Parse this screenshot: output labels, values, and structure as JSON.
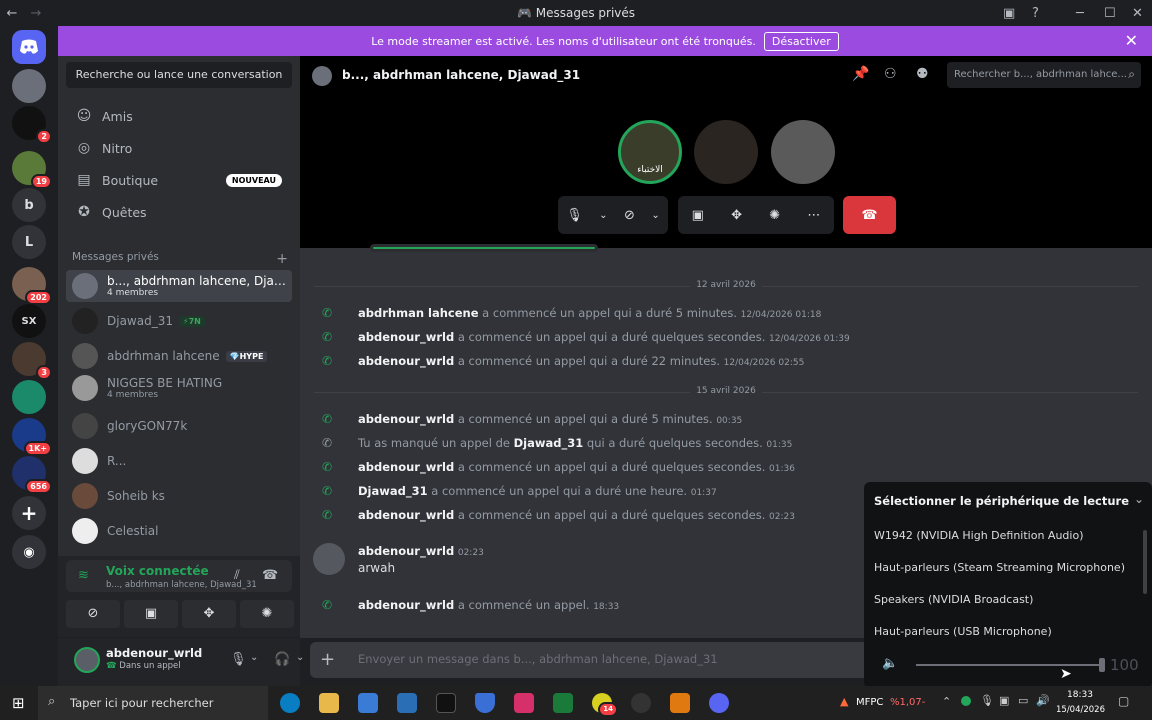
{
  "window": {
    "title": "Messages privés",
    "back": "←",
    "forward": "→"
  },
  "streamer": {
    "text": "Le mode streamer est activé. Les noms d'utilisateur ont été tronqués.",
    "button": "Désactiver"
  },
  "guilds": [
    {
      "label": "",
      "badge": ""
    },
    {
      "label": "",
      "badge": "2"
    },
    {
      "label": "",
      "badge": "19"
    },
    {
      "label": "b",
      "badge": ""
    },
    {
      "label": "L",
      "badge": ""
    },
    {
      "label": "",
      "badge": "202"
    },
    {
      "label": "SX",
      "badge": ""
    },
    {
      "label": "",
      "badge": "3"
    },
    {
      "label": "",
      "badge": ""
    },
    {
      "label": "",
      "badge": "1K+"
    },
    {
      "label": "",
      "badge": "656"
    }
  ],
  "sidebar": {
    "search": "Recherche ou lance une conversation",
    "nav": [
      {
        "label": "Amis",
        "icon": "friends-icon"
      },
      {
        "label": "Nitro",
        "icon": "nitro-icon"
      },
      {
        "label": "Boutique",
        "icon": "shop-icon",
        "badge": "NOUVEAU"
      },
      {
        "label": "Quêtes",
        "icon": "quests-icon"
      }
    ],
    "section": "Messages privés",
    "add": "+",
    "dms": [
      {
        "name": "b..., abdrhman lahcene, Djawad...",
        "sub": "4 membres",
        "tag": ""
      },
      {
        "name": "Djawad_31",
        "sub": "",
        "tag": "⚡7N"
      },
      {
        "name": "abdrhman lahcene",
        "sub": "",
        "tag": "💎HYPE"
      },
      {
        "name": "NIGGES BE HATING",
        "sub": "4 membres",
        "tag": ""
      },
      {
        "name": "gloryGON77k",
        "sub": "",
        "tag": ""
      },
      {
        "name": "R...",
        "sub": "",
        "tag": ""
      },
      {
        "name": "Soheib ks",
        "sub": "",
        "tag": ""
      },
      {
        "name": "Celestial",
        "sub": "",
        "tag": ""
      }
    ]
  },
  "voice": {
    "status": "Voix connectée",
    "channel": "b..., abdrhman lahcene, Djawad_31"
  },
  "user": {
    "name": "abdenour_wrld",
    "status": "Dans un appel"
  },
  "header": {
    "title": "b..., abdrhman lahcene, Djawad_31",
    "search_placeholder": "Rechercher b..., abdrhman lahce..."
  },
  "call": {
    "avatar1_label": "الاختباء"
  },
  "messages": {
    "date1": "12 avril 2026",
    "date2": "15 avril 2026",
    "lines": [
      {
        "user": "abdrhman lahcene",
        "text": " a commencé un appel qui a duré 5 minutes. ",
        "ts": "12/04/2026 01:18",
        "missed": false
      },
      {
        "user": "abdenour_wrld",
        "text": " a commencé un appel qui a duré quelques secondes. ",
        "ts": "12/04/2026 01:39",
        "missed": false
      },
      {
        "user": "abdenour_wrld",
        "text": " a commencé un appel qui a duré 22 minutes. ",
        "ts": "12/04/2026 02:55",
        "missed": false
      },
      {
        "user": "abdenour_wrld",
        "text": " a commencé un appel qui a duré 5 minutes. ",
        "ts": "00:35",
        "missed": false
      },
      {
        "user": "Djawad_31",
        "text": " qui a duré quelques secondes. ",
        "ts": "01:35",
        "missed": true,
        "prefix": "Tu as manqué un appel de "
      },
      {
        "user": "abdenour_wrld",
        "text": " a commencé un appel qui a duré quelques secondes. ",
        "ts": "01:36",
        "missed": false
      },
      {
        "user": "Djawad_31",
        "text": " a commencé un appel qui a duré une heure. ",
        "ts": "01:37",
        "missed": false
      },
      {
        "user": "abdenour_wrld",
        "text": " a commencé un appel qui a duré quelques secondes. ",
        "ts": "02:23",
        "missed": false
      }
    ],
    "msg": {
      "user": "abdenour_wrld",
      "ts": "02:23",
      "text": "arwah"
    },
    "last": {
      "user": "abdenour_wrld",
      "text": " a commencé un appel. ",
      "ts": "18:33"
    }
  },
  "composer": {
    "placeholder": "Envoyer un message dans b..., abdrhman lahcene, Djawad_31"
  },
  "popup": {
    "title": "Sélectionner le périphérique de lecture",
    "items": [
      "W1942 (NVIDIA High Definition Audio)",
      "Haut-parleurs (Steam Streaming Microphone)",
      "Speakers (NVIDIA Broadcast)",
      "Haut-parleurs (USB Microphone)"
    ],
    "volume": "100",
    "volume_level": 1.0
  },
  "taskbar": {
    "search": "Taper ici pour rechercher",
    "stock": "MFPC",
    "stock_change": "%1,07-",
    "time": "18:33",
    "date": "15/04/2026",
    "badge": "14"
  }
}
